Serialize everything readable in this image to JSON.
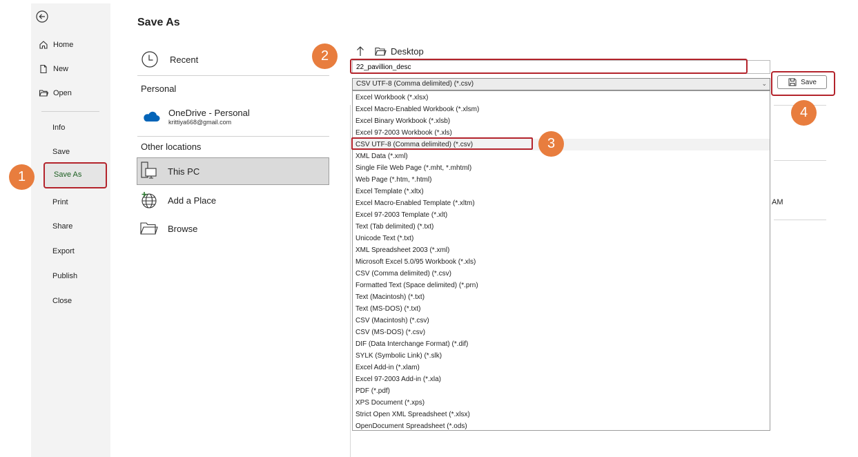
{
  "nav": {
    "home": "Home",
    "new": "New",
    "open": "Open",
    "info": "Info",
    "save": "Save",
    "save_as": "Save As",
    "print": "Print",
    "share": "Share",
    "export": "Export",
    "publish": "Publish",
    "close": "Close"
  },
  "page_title": "Save As",
  "locations": {
    "recent": "Recent",
    "personal_header": "Personal",
    "onedrive_name": "OneDrive - Personal",
    "onedrive_email": "krittiya668@gmail.com",
    "other_header": "Other locations",
    "this_pc": "This PC",
    "add_place": "Add a Place",
    "browse": "Browse"
  },
  "breadcrumb": {
    "folder": "Desktop"
  },
  "filename": {
    "value": "22_pavillion_desc"
  },
  "file_type": {
    "selected": "CSV UTF-8 (Comma delimited) (*.csv)",
    "options": [
      "Excel Workbook (*.xlsx)",
      "Excel Macro-Enabled Workbook (*.xlsm)",
      "Excel Binary Workbook (*.xlsb)",
      "Excel 97-2003 Workbook (*.xls)",
      "CSV UTF-8 (Comma delimited) (*.csv)",
      "XML Data (*.xml)",
      "Single File Web Page (*.mht, *.mhtml)",
      "Web Page (*.htm, *.html)",
      "Excel Template (*.xltx)",
      "Excel Macro-Enabled Template (*.xltm)",
      "Excel 97-2003 Template (*.xlt)",
      "Text (Tab delimited) (*.txt)",
      "Unicode Text (*.txt)",
      "XML Spreadsheet 2003 (*.xml)",
      "Microsoft Excel 5.0/95 Workbook (*.xls)",
      "CSV (Comma delimited) (*.csv)",
      "Formatted Text (Space delimited) (*.prn)",
      "Text (Macintosh) (*.txt)",
      "Text (MS-DOS) (*.txt)",
      "CSV (Macintosh) (*.csv)",
      "CSV (MS-DOS) (*.csv)",
      "DIF (Data Interchange Format) (*.dif)",
      "SYLK (Symbolic Link) (*.slk)",
      "Excel Add-in (*.xlam)",
      "Excel 97-2003 Add-in (*.xla)",
      "PDF (*.pdf)",
      "XPS Document (*.xps)",
      "Strict Open XML Spreadsheet (*.xlsx)",
      "OpenDocument Spreadsheet (*.ods)"
    ]
  },
  "save_button": "Save",
  "steps": [
    "1",
    "2",
    "3",
    "4"
  ],
  "right_fragment": "AM",
  "colors": {
    "step_badge": "#e87d3e",
    "highlight_border": "#b3232b",
    "nav_background": "#f3f3f3",
    "active_nav_text": "#1b5e20",
    "onedrive_blue": "#0364b8"
  }
}
